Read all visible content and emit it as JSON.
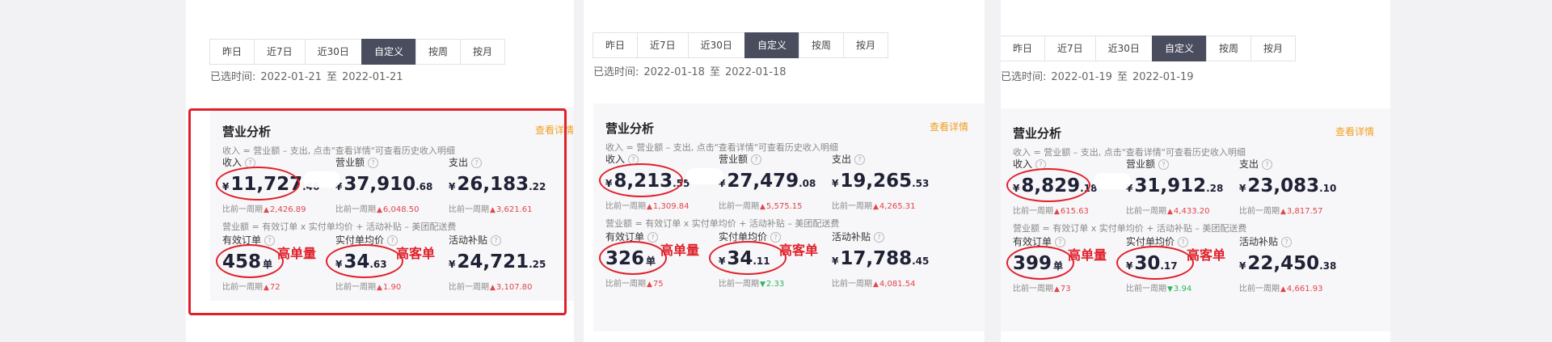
{
  "tabs": [
    "昨日",
    "近7日",
    "近30日",
    "自定义",
    "按周",
    "按月"
  ],
  "active_tab_index": 3,
  "date_prefix": "已选时间:",
  "date_sep": "至",
  "card_title": "营业分析",
  "detail_link": "查看详情",
  "formula1": "收入 = 营业额 – 支出, 点击\"查看详情\"可查看历史收入明细",
  "formula2": "营业额 = 有效订单 x 实付单均价 + 活动补贴 – 美团配送费",
  "labels": {
    "income": "收入",
    "revenue": "营业额",
    "expense": "支出",
    "orders": "有效订单",
    "avg_price": "实付单均价",
    "subsidy": "活动补贴"
  },
  "compare_label": "比前一周期",
  "currency": "¥",
  "order_unit": "单",
  "help_glyph": "?",
  "arrow_up": "▲",
  "arrow_down": "▼",
  "annotations": {
    "high_orders": "高单量",
    "high_price": "高客单"
  },
  "accent_colors": {
    "active_tab": "#4a4d5e",
    "link": "#f0a020",
    "up": "#e2454a",
    "down": "#2fb35b",
    "annotation": "#e0202a"
  },
  "panels": [
    {
      "date_start": "2022-01-21",
      "date_end": "2022-01-21",
      "income": {
        "int": "11,727",
        "dec": ".46",
        "delta": "2,426.89",
        "dir": "up"
      },
      "revenue": {
        "int": "37,910",
        "dec": ".68",
        "delta": "6,048.50",
        "dir": "up"
      },
      "expense": {
        "int": "26,183",
        "dec": ".22",
        "delta": "3,621.61",
        "dir": "up"
      },
      "orders": {
        "int": "458",
        "dec": "",
        "delta": "72",
        "dir": "up"
      },
      "avg_price": {
        "int": "34",
        "dec": ".63",
        "delta": "1.90",
        "dir": "up"
      },
      "subsidy": {
        "int": "24,721",
        "dec": ".25",
        "delta": "3,107.80",
        "dir": "up"
      }
    },
    {
      "date_start": "2022-01-18",
      "date_end": "2022-01-18",
      "income": {
        "int": "8,213",
        "dec": ".55",
        "delta": "1,309.84",
        "dir": "up"
      },
      "revenue": {
        "int": "27,479",
        "dec": ".08",
        "delta": "5,575.15",
        "dir": "up"
      },
      "expense": {
        "int": "19,265",
        "dec": ".53",
        "delta": "4,265.31",
        "dir": "up"
      },
      "orders": {
        "int": "326",
        "dec": "",
        "delta": "75",
        "dir": "up"
      },
      "avg_price": {
        "int": "34",
        "dec": ".11",
        "delta": "2.33",
        "dir": "down"
      },
      "subsidy": {
        "int": "17,788",
        "dec": ".45",
        "delta": "4,081.54",
        "dir": "up"
      }
    },
    {
      "date_start": "2022-01-19",
      "date_end": "2022-01-19",
      "income": {
        "int": "8,829",
        "dec": ".18",
        "delta": "615.63",
        "dir": "up"
      },
      "revenue": {
        "int": "31,912",
        "dec": ".28",
        "delta": "4,433.20",
        "dir": "up"
      },
      "expense": {
        "int": "23,083",
        "dec": ".10",
        "delta": "3,817.57",
        "dir": "up"
      },
      "orders": {
        "int": "399",
        "dec": "",
        "delta": "73",
        "dir": "up"
      },
      "avg_price": {
        "int": "30",
        "dec": ".17",
        "delta": "3.94",
        "dir": "down"
      },
      "subsidy": {
        "int": "22,450",
        "dec": ".38",
        "delta": "4,661.93",
        "dir": "up"
      }
    }
  ]
}
